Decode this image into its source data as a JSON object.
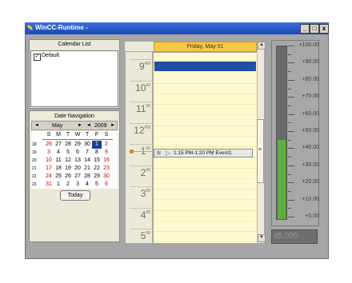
{
  "window": {
    "title": "WinCC-Runtime -",
    "minimize": "_",
    "maximize": "□",
    "close": "x"
  },
  "calendar_list": {
    "header": "Calendar List",
    "items": [
      {
        "label": "Default",
        "checked": true
      }
    ]
  },
  "date_nav": {
    "header": "Date Navigation",
    "month": "May",
    "year": "2009",
    "day_headers": [
      "S",
      "M",
      "T",
      "W",
      "T",
      "F",
      "S"
    ],
    "weeks": [
      {
        "num": "18",
        "days": [
          "26",
          "27",
          "28",
          "29",
          "30",
          "1",
          "2"
        ]
      },
      {
        "num": "19",
        "days": [
          "3",
          "4",
          "5",
          "6",
          "7",
          "8",
          "9"
        ]
      },
      {
        "num": "20",
        "days": [
          "10",
          "11",
          "12",
          "13",
          "14",
          "15",
          "16"
        ]
      },
      {
        "num": "21",
        "days": [
          "17",
          "18",
          "19",
          "20",
          "21",
          "22",
          "23"
        ]
      },
      {
        "num": "22",
        "days": [
          "24",
          "25",
          "26",
          "27",
          "28",
          "29",
          "30"
        ]
      },
      {
        "num": "23",
        "days": [
          "31",
          "1",
          "2",
          "3",
          "4",
          "5",
          "6"
        ]
      }
    ],
    "selected_day": "1",
    "today_label": "Today",
    "prev_month": "◄",
    "next_month": "►",
    "prev_year": "◄",
    "next_year": "►"
  },
  "scheduler": {
    "day_header": "Friday, May 01",
    "hours": [
      {
        "h": "9",
        "suffix": "AM"
      },
      {
        "h": "10",
        "suffix": "00"
      },
      {
        "h": "11",
        "suffix": "00"
      },
      {
        "h": "12",
        "suffix": "PM"
      },
      {
        "h": "1",
        "suffix": "00"
      },
      {
        "h": "2",
        "suffix": "00"
      },
      {
        "h": "3",
        "suffix": "00"
      },
      {
        "h": "4",
        "suffix": "00"
      },
      {
        "h": "5",
        "suffix": "00"
      }
    ],
    "event": {
      "text": "1:15 PM-1:20 PM Event1"
    },
    "scroll_up": "▲",
    "scroll_down": "▼",
    "thumb_grip": "≡"
  },
  "gauge": {
    "labels": [
      "+100.00",
      "+90.00",
      "+80.00",
      "+70.00",
      "+60.00",
      "+50.00",
      "+40.00",
      "+30.00",
      "+20.00",
      "+10.00",
      "+0.00"
    ],
    "value": 45,
    "max": 100,
    "min": 0,
    "value_text": "45.000",
    "fill_color": "#5fb03c"
  }
}
